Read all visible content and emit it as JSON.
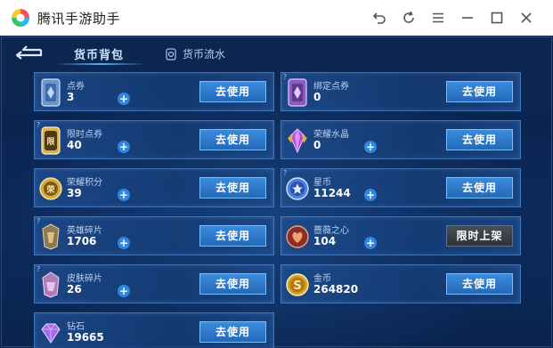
{
  "window": {
    "title": "腾讯手游助手"
  },
  "tabs": {
    "active": "货币背包",
    "flow": "货币流水"
  },
  "colors": {
    "button_blue": "#2e7bd0",
    "button_gray": "#3a3f47",
    "panel_bg": "#0c2755",
    "plus_blue": "#2e86e0"
  },
  "currencies": [
    {
      "name": "点券",
      "value": "3",
      "icon": "coupon-card-icon",
      "has_plus": true,
      "action": "去使用"
    },
    {
      "name": "绑定点券",
      "value": "0",
      "icon": "bound-coupon-card-icon",
      "has_plus": false,
      "action": "去使用"
    },
    {
      "name": "限时点券",
      "value": "40",
      "icon": "limited-coupon-icon",
      "has_plus": true,
      "action": "去使用"
    },
    {
      "name": "荣耀水晶",
      "value": "0",
      "icon": "glory-crystal-icon",
      "has_plus": true,
      "action": "去使用"
    },
    {
      "name": "荣耀积分",
      "value": "39",
      "icon": "glory-points-icon",
      "has_plus": true,
      "action": "去使用"
    },
    {
      "name": "星币",
      "value": "11244",
      "icon": "star-coin-icon",
      "has_plus": true,
      "action": "去使用"
    },
    {
      "name": "英雄碎片",
      "value": "1706",
      "icon": "hero-fragment-icon",
      "has_plus": true,
      "action": "去使用"
    },
    {
      "name": "蔷薇之心",
      "value": "104",
      "icon": "rose-heart-icon",
      "has_plus": true,
      "action": "限时上架"
    },
    {
      "name": "皮肤碎片",
      "value": "26",
      "icon": "skin-fragment-icon",
      "has_plus": true,
      "action": "去使用"
    },
    {
      "name": "金币",
      "value": "264820",
      "icon": "gold-coin-icon",
      "has_plus": false,
      "action": "去使用"
    },
    {
      "name": "钻石",
      "value": "19665",
      "icon": "diamond-icon",
      "has_plus": false,
      "action": "去使用"
    }
  ]
}
